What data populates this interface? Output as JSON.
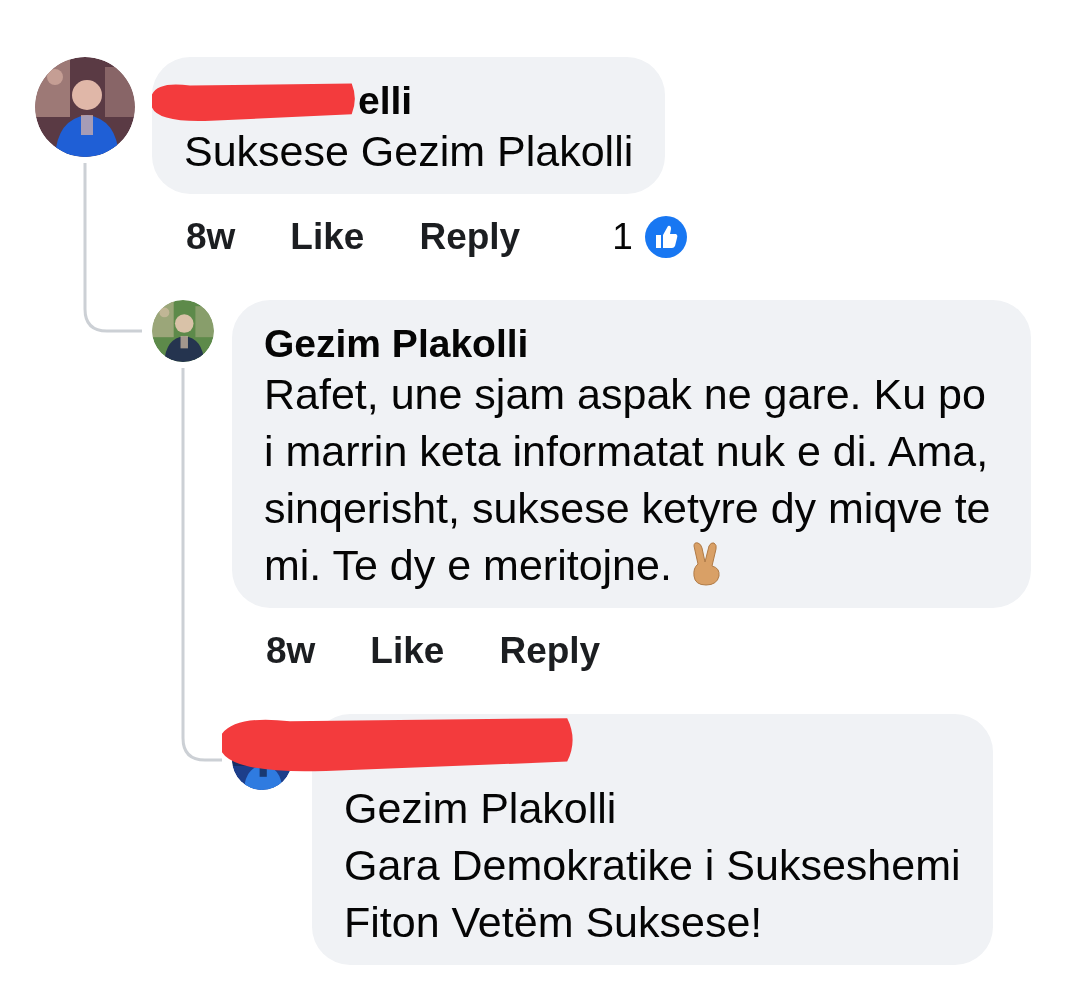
{
  "comments": [
    {
      "author": "elli",
      "author_redacted": true,
      "text": "Suksese Gezim Plakolli",
      "time": "8w",
      "actions": [
        "Like",
        "Reply"
      ],
      "reaction_count": "1",
      "replies": [
        {
          "author": "Gezim Plakolli",
          "author_redacted": false,
          "text": "Rafet, une sjam aspak ne gare. Ku po i marrin keta informatat nuk e di. Ama, sinqerisht, suksese ketyre dy miqve te mi. Te dy e meritojne.",
          "has_emoji": true,
          "time": "8w",
          "actions": [
            "Like",
            "Reply"
          ],
          "replies": [
            {
              "author_redacted": true,
              "text": "Gezim Plakolli\nGara Demokratike i Sukseshemi\nFiton Vetëm Suksese!"
            }
          ]
        }
      ]
    }
  ]
}
